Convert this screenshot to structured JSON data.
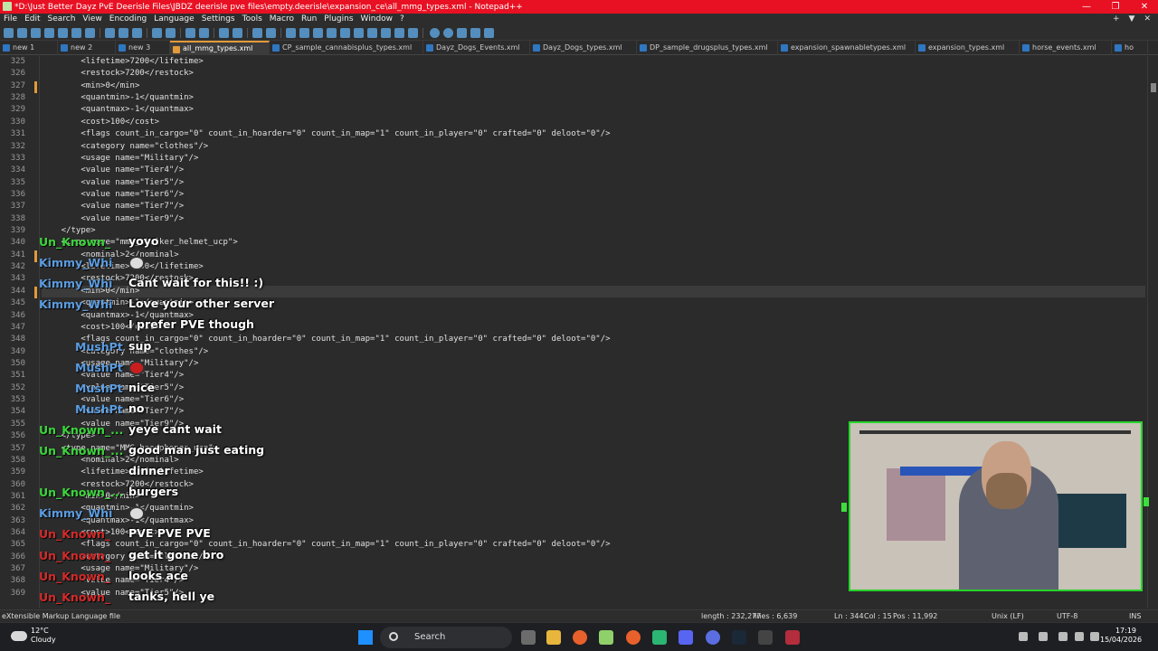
{
  "titlebar": {
    "title": "*D:\\Just Better Dayz PvE Deerisle Files\\JBDZ deerisle pve files\\empty.deerisle\\expansion_ce\\all_mmg_types.xml - Notepad++",
    "minimize": "—",
    "maximize": "❐",
    "close": "✕"
  },
  "menu": {
    "items": [
      "File",
      "Edit",
      "Search",
      "View",
      "Encoding",
      "Language",
      "Settings",
      "Tools",
      "Macro",
      "Run",
      "Plugins",
      "Window",
      "?"
    ],
    "right": [
      "+",
      "▼",
      "✕"
    ]
  },
  "tabs": [
    {
      "label": "new 1"
    },
    {
      "label": "new 2"
    },
    {
      "label": "new 3"
    },
    {
      "label": "all_mmg_types.xml",
      "active": true
    },
    {
      "label": "CP_sample_cannabisplus_types.xml"
    },
    {
      "label": "Dayz_Dogs_Events.xml"
    },
    {
      "label": "Dayz_Dogs_types.xml"
    },
    {
      "label": "DP_sample_drugsplus_types.xml"
    },
    {
      "label": "expansion_spawnabletypes.xml"
    },
    {
      "label": "expansion_types.xml"
    },
    {
      "label": "horse_events.xml"
    },
    {
      "label": "ho"
    }
  ],
  "editor": {
    "line_numbers": [
      "325",
      "326",
      "327",
      "328",
      "329",
      "330",
      "331",
      "332",
      "333",
      "334",
      "335",
      "336",
      "337",
      "338",
      "339",
      "340",
      "341",
      "342",
      "343",
      "344",
      "345",
      "346",
      "347",
      "348",
      "349",
      "350",
      "351",
      "352",
      "353",
      "354",
      "355",
      "356",
      "357",
      "358",
      "359",
      "360",
      "361",
      "362",
      "363",
      "364",
      "365",
      "366",
      "367",
      "368",
      "369"
    ],
    "lines": [
      "        <lifetime>7200</lifetime>",
      "        <restock>7200</restock>",
      "        <min>0</min>",
      "        <quantmin>-1</quantmin>",
      "        <quantmax>-1</quantmax>",
      "        <cost>100</cost>",
      "        <flags count_in_cargo=\"0\" count_in_hoarder=\"0\" count_in_map=\"1\" count_in_player=\"0\" crafted=\"0\" deloot=\"0\"/>",
      "        <category name=\"clothes\"/>",
      "        <usage name=\"Military\"/>",
      "        <value name=\"Tier4\"/>",
      "        <value name=\"Tier5\"/>",
      "        <value name=\"Tier6\"/>",
      "        <value name=\"Tier7\"/>",
      "        <value name=\"Tier9\"/>",
      "    </type>",
      "    <type name=\"mmg_striker_helmet_ucp\">",
      "        <nominal>2</nominal>",
      "        <lifetime>7200</lifetime>",
      "        <restock>7200</restock>",
      "        <min>0</min>",
      "        <quantmin>-1</quantmin>",
      "        <quantmax>-1</quantmax>",
      "        <cost>100</cost>",
      "        <flags count_in_cargo=\"0\" count_in_hoarder=\"0\" count_in_map=\"1\" count_in_player=\"0\" crafted=\"0\" deloot=\"0\"/>",
      "        <category name=\"clothes\"/>",
      "        <usage name=\"Military\"/>",
      "        <value name=\"Tier4\"/>",
      "        <value name=\"Tier5\"/>",
      "        <value name=\"Tier6\"/>",
      "        <value name=\"Tier7\"/>",
      "        <value name=\"Tier9\"/>",
      "    </type>",
      "    <type name=\"MMG_headphones_ucp\">",
      "        <nominal>2</nominal>",
      "        <lifetime>7200</lifetime>",
      "        <restock>7200</restock>",
      "        <min>0</min>",
      "        <quantmin>-1</quantmin>",
      "        <quantmax>-1</quantmax>",
      "        <cost>100</cost>",
      "        <flags count_in_cargo=\"0\" count_in_hoarder=\"0\" count_in_map=\"1\" count_in_player=\"0\" crafted=\"0\" deloot=\"0\"/>",
      "        <category name=\"clothes\"/>",
      "        <usage name=\"Military\"/>",
      "        <value name=\"Tier4\"/>",
      "        <value name=\"Tier5\"/>"
    ]
  },
  "chat": [
    {
      "user": "Un_Known_",
      "text": "yoyo",
      "color": "#3cd43c",
      "indent": 0
    },
    {
      "user": "Kimmy_Whi",
      "text": "",
      "emote": "white",
      "color": "#5b9ce0",
      "indent": 0
    },
    {
      "user": "Kimmy_Whi",
      "text": "Cant wait for this!! :)",
      "color": "#5b9ce0",
      "indent": 0
    },
    {
      "user": "Kimmy_Whi",
      "text": "Love your other server",
      "color": "#5b9ce0",
      "indent": 0
    },
    {
      "user": "",
      "text": "I prefer PVE though",
      "color": "#5b9ce0",
      "indent": 0
    },
    {
      "user": "MushPt",
      "text": "sup",
      "color": "#5b9ce0",
      "indent": 40
    },
    {
      "user": "MushPt",
      "text": "",
      "emote": "red",
      "color": "#5b9ce0",
      "indent": 40
    },
    {
      "user": "MushPt",
      "text": "nice",
      "color": "#5b9ce0",
      "indent": 40
    },
    {
      "user": "MushPt",
      "text": "no",
      "color": "#5b9ce0",
      "indent": 40
    },
    {
      "user": "Un_Known_...",
      "text": "yeye cant wait",
      "color": "#3cd43c",
      "indent": 0
    },
    {
      "user": "Un_Known_...",
      "text": "good man just eating",
      "color": "#3cd43c",
      "indent": 0
    },
    {
      "user": "",
      "text": "dinner",
      "color": "#3cd43c",
      "indent": 0
    },
    {
      "user": "Un_Known_...",
      "text": "burgers",
      "color": "#3cd43c",
      "indent": 0
    },
    {
      "user": "Kimmy_Whi",
      "text": "",
      "emote": "white",
      "color": "#5b9ce0",
      "indent": 0
    },
    {
      "user": "Un_Known_",
      "text": "PVE PVE PVE",
      "color": "#d42a2a",
      "indent": 0
    },
    {
      "user": "Un_Known_",
      "text": "get it gone bro",
      "color": "#d42a2a",
      "indent": 0
    },
    {
      "user": "Un_Known_",
      "text": "looks ace",
      "color": "#d42a2a",
      "indent": 0
    },
    {
      "user": "Un_Known_",
      "text": "tanks, hell ye",
      "color": "#d42a2a",
      "indent": 0
    }
  ],
  "statusbar": {
    "filetype": "eXtensible Markup Language file",
    "length": "length : 232,277",
    "lines": "lines : 6,639",
    "ln": "Ln : 344",
    "col": "Col : 15",
    "pos": "Pos : 11,992",
    "eol": "Unix (LF)",
    "encoding": "UTF-8",
    "ins": "INS"
  },
  "taskbar": {
    "weather_temp": "12°C",
    "weather_desc": "Cloudy",
    "search_label": "Search",
    "time": "17:19",
    "date": "15/04/2026"
  },
  "colors": {
    "titlebar": "#e81123",
    "webcam_border": "#26d52b",
    "chat_green": "#3cd43c",
    "chat_blue": "#5b9ce0",
    "chat_red": "#d42a2a"
  }
}
